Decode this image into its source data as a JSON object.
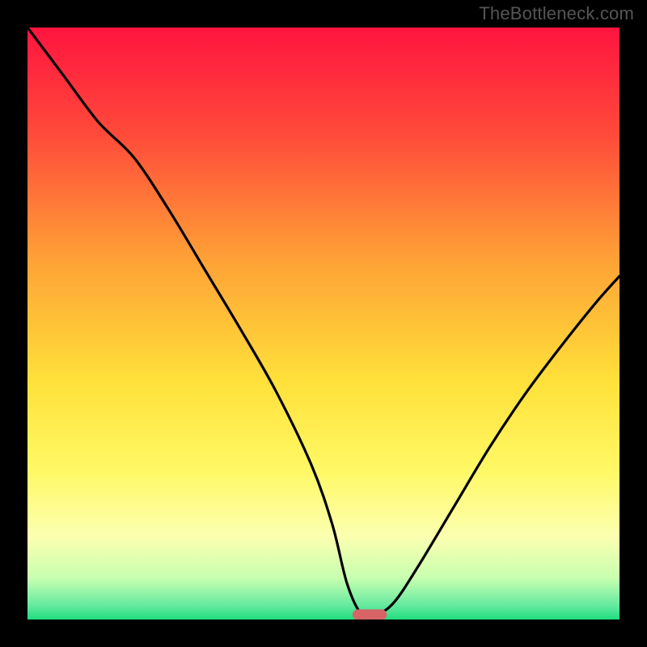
{
  "watermark": "TheBottleneck.com",
  "chart_data": {
    "type": "line",
    "title": "",
    "xlabel": "",
    "ylabel": "",
    "xlim": [
      0,
      100
    ],
    "ylim": [
      0,
      100
    ],
    "grid": false,
    "legend": null,
    "annotations": [],
    "background": {
      "kind": "gradient-vertical",
      "stops": [
        {
          "pos": 0.0,
          "color": "#ff143f"
        },
        {
          "pos": 0.18,
          "color": "#ff4a3a"
        },
        {
          "pos": 0.4,
          "color": "#ffa436"
        },
        {
          "pos": 0.6,
          "color": "#ffe13a"
        },
        {
          "pos": 0.75,
          "color": "#fff966"
        },
        {
          "pos": 0.86,
          "color": "#fcffb0"
        },
        {
          "pos": 0.93,
          "color": "#c8ffb0"
        },
        {
          "pos": 0.975,
          "color": "#68eaa0"
        },
        {
          "pos": 1.0,
          "color": "#1fde7f"
        }
      ]
    },
    "x": [
      0,
      6,
      12,
      18,
      24,
      30,
      36,
      42,
      48,
      51.5,
      54,
      56.5,
      59,
      62,
      66,
      72,
      78,
      84,
      90,
      96,
      100
    ],
    "series": [
      {
        "name": "bottleneck-curve",
        "values": [
          100,
          92,
          84,
          78,
          69,
          59,
          49,
          38.5,
          26,
          16,
          6,
          0.8,
          0.8,
          3,
          9,
          19,
          29,
          38,
          46,
          53.5,
          58
        ]
      }
    ],
    "marker": {
      "name": "optimal-pill",
      "x_center": 57.8,
      "y": 0.8,
      "width": 5.8,
      "height": 1.8,
      "color": "#d86468"
    }
  }
}
